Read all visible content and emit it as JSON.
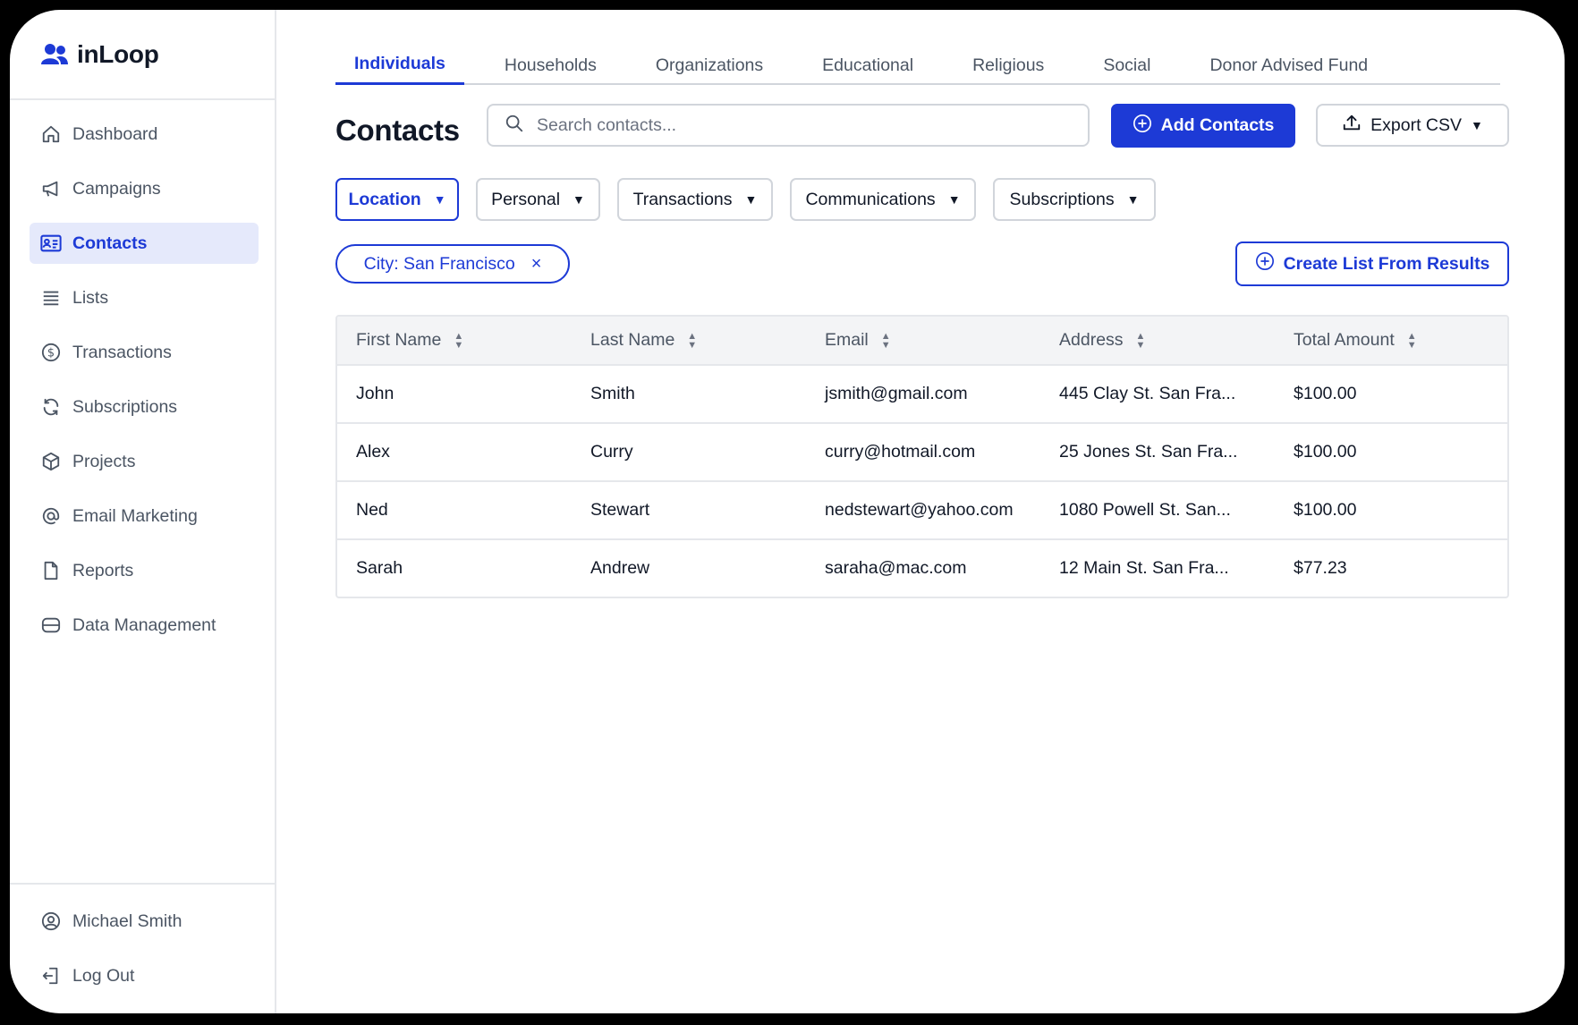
{
  "brand": {
    "name": "inLoop"
  },
  "colors": {
    "accent": "#1d3ad6",
    "active_bg": "#e5e9fb",
    "border": "#d1d5db"
  },
  "sidebar": {
    "items": [
      {
        "label": "Dashboard",
        "icon": "home-icon"
      },
      {
        "label": "Campaigns",
        "icon": "megaphone-icon"
      },
      {
        "label": "Contacts",
        "icon": "contact-card-icon",
        "active": true
      },
      {
        "label": "Lists",
        "icon": "list-icon"
      },
      {
        "label": "Transactions",
        "icon": "dollar-circle-icon"
      },
      {
        "label": "Subscriptions",
        "icon": "refresh-icon"
      },
      {
        "label": "Projects",
        "icon": "cube-icon"
      },
      {
        "label": "Email Marketing",
        "icon": "at-sign-icon"
      },
      {
        "label": "Reports",
        "icon": "document-icon"
      },
      {
        "label": "Data Management",
        "icon": "database-icon"
      }
    ],
    "bottom": [
      {
        "label": "Michael Smith",
        "icon": "user-circle-icon"
      },
      {
        "label": "Log Out",
        "icon": "logout-icon"
      }
    ]
  },
  "tabs": [
    {
      "label": "Individuals",
      "active": true
    },
    {
      "label": "Households"
    },
    {
      "label": "Organizations"
    },
    {
      "label": "Educational"
    },
    {
      "label": "Religious"
    },
    {
      "label": "Social"
    },
    {
      "label": "Donor Advised Fund"
    }
  ],
  "header": {
    "title": "Contacts",
    "search_placeholder": "Search contacts...",
    "add_label": "Add Contacts",
    "export_label": "Export CSV"
  },
  "filters": [
    {
      "label": "Location",
      "active": true
    },
    {
      "label": "Personal"
    },
    {
      "label": "Transactions"
    },
    {
      "label": "Communications"
    },
    {
      "label": "Subscriptions"
    }
  ],
  "active_filter_chip": {
    "label": "City: San Francisco",
    "close": "×"
  },
  "create_list_label": "Create List From Results",
  "table": {
    "columns": [
      "First Name",
      "Last Name",
      "Email",
      "Address",
      "Total Amount"
    ],
    "rows": [
      [
        "John",
        "Smith",
        "jsmith@gmail.com",
        "445 Clay St. San Fra...",
        "$100.00"
      ],
      [
        "Alex",
        "Curry",
        "curry@hotmail.com",
        "25 Jones St. San Fra...",
        "$100.00"
      ],
      [
        "Ned",
        "Stewart",
        "nedstewart@yahoo.com",
        "1080 Powell St. San...",
        "$100.00"
      ],
      [
        "Sarah",
        "Andrew",
        "saraha@mac.com",
        "12 Main St. San Fra...",
        "$77.23"
      ]
    ]
  }
}
